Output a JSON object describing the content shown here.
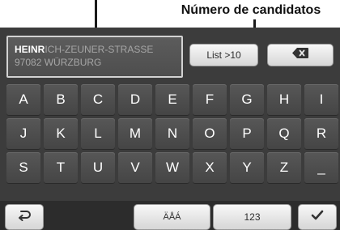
{
  "callout": {
    "label": "Número de candidatos"
  },
  "address": {
    "typed": "HEINR",
    "suggestion_rest": "ICH-ZEUNER-STRASSE",
    "line2": "97082 WÜRZBURG"
  },
  "buttons": {
    "list_label": "List >10",
    "delete_icon": "backspace-icon",
    "back_icon": "return-arrow-icon",
    "umlaut_label": "ÄÅÁ",
    "numbers_label": "123",
    "confirm_icon": "checkmark-icon"
  },
  "keys": [
    "A",
    "B",
    "C",
    "D",
    "E",
    "F",
    "G",
    "H",
    "I",
    "J",
    "K",
    "L",
    "M",
    "N",
    "O",
    "P",
    "Q",
    "R",
    "S",
    "T",
    "U",
    "V",
    "W",
    "X",
    "Y",
    "Z",
    "_"
  ],
  "colors": {
    "screen_background": "#3c3c3c",
    "key_background": "#4f4f4f",
    "button_background": "#e6e6e6",
    "typed_text": "#ffffff",
    "suggestion_text": "#a6a6a6"
  }
}
